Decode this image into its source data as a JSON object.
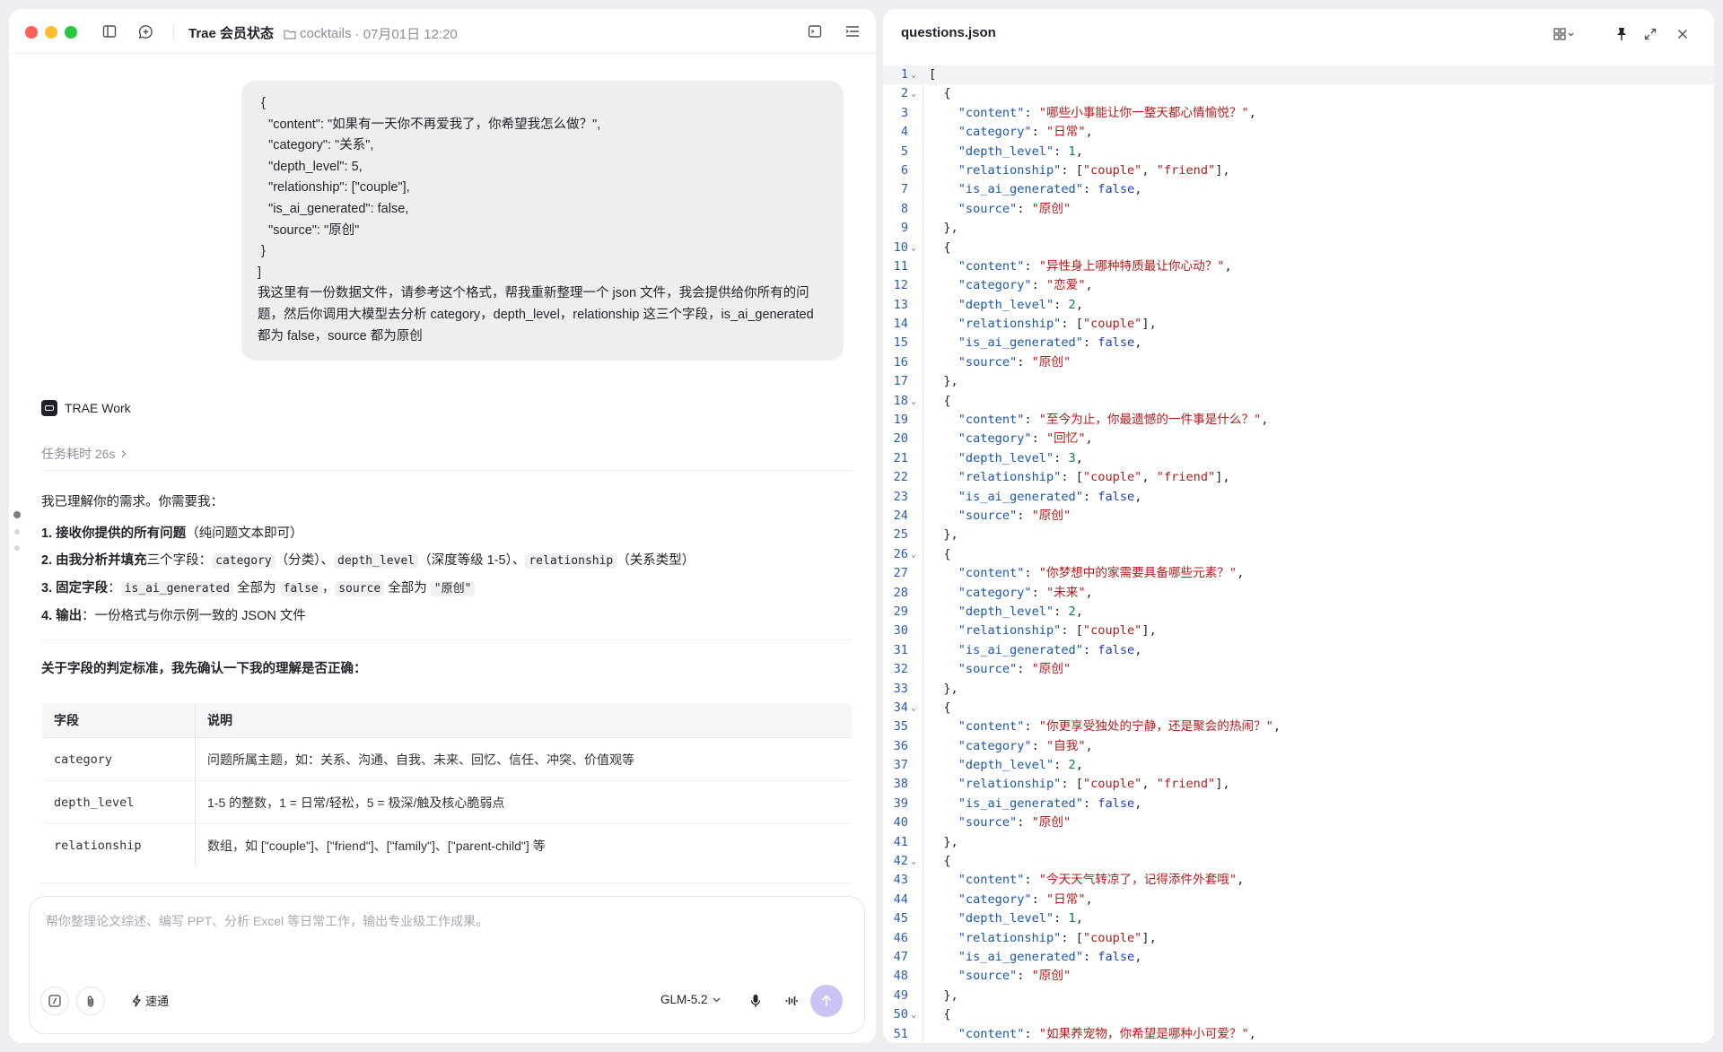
{
  "left": {
    "title": "Trae 会员状态",
    "meta_folder": "cocktails",
    "meta_time": "· 07月01日 12:20",
    "user_message": {
      "code_lines": [
        " {",
        "   \"content\": \"如果有一天你不再爱我了，你希望我怎么做？\",",
        "   \"category\": \"关系\",",
        "   \"depth_level\": 5,",
        "   \"relationship\": [\"couple\"],",
        "   \"is_ai_generated\": false,",
        "   \"source\": \"原创\"",
        " }",
        "]"
      ],
      "text_lines": [
        "我这里有一份数据文件，请参考这个格式，帮我重新整理一个 json 文件，我会提供给你所有的问",
        "题，然后你调用大模型去分析 category，depth_level，relationship 这三个字段，is_ai_generated",
        "都为 false，source 都为原创"
      ]
    },
    "agent_name": "TRAE Work",
    "task_time": "任务耗时 26s",
    "intro": "我已理解你的需求。你需要我：",
    "steps": {
      "s1_bold": "1. 接收你提供的所有问题",
      "s1_rest": "（纯问题文本即可）",
      "s2_bold": "2. 由我分析并填充",
      "s2_a": "三个字段：",
      "s2_code1": "category",
      "s2_b": "（分类）、",
      "s2_code2": "depth_level",
      "s2_c": "（深度等级 1-5）、",
      "s2_code3": "relationship",
      "s2_d": "（关系类型）",
      "s3_bold": "3. 固定字段",
      "s3_a": "：",
      "s3_code1": "is_ai_generated",
      "s3_b": " 全部为 ",
      "s3_code2": "false",
      "s3_c": "，",
      "s3_code3": "source",
      "s3_d": " 全部为 ",
      "s3_code4": "\"原创\"",
      "s4_bold": "4. 输出",
      "s4_rest": "：一份格式与你示例一致的 JSON 文件"
    },
    "confirm_heading": "关于字段的判定标准，我先确认一下我的理解是否正确：",
    "table": {
      "headers": [
        "字段",
        "说明"
      ],
      "rows": [
        [
          "category",
          "问题所属主题，如：关系、沟通、自我、未来、回忆、信任、冲突、价值观等"
        ],
        [
          "depth_level",
          "1-5 的整数，1 = 日常/轻松，5 = 极深/触及核心脆弱点"
        ],
        [
          "relationship",
          "数组，如 [\"couple\"]、[\"friend\"]、[\"family\"]、[\"parent-child\"] 等"
        ]
      ]
    },
    "composer": {
      "placeholder": "帮你整理论文综述、编写 PPT、分析 Excel 等日常工作，输出专业级工作成果。",
      "speed_label": "速通",
      "model_label": "GLM-5.2"
    }
  },
  "right": {
    "file_name": "questions.json",
    "lines": [
      {
        "n": "1",
        "fold": true,
        "t": "["
      },
      {
        "n": "2",
        "fold": true,
        "t": "  {"
      },
      {
        "n": "3",
        "key": "content",
        "val": "\"哪些小事能让你一整天都心情愉悦？\"",
        "vt": "s"
      },
      {
        "n": "4",
        "key": "category",
        "val": "\"日常\"",
        "vt": "s"
      },
      {
        "n": "5",
        "key": "depth_level",
        "val": "1",
        "vt": "n"
      },
      {
        "n": "6",
        "key": "relationship",
        "arr": [
          "couple",
          "friend"
        ]
      },
      {
        "n": "7",
        "key": "is_ai_generated",
        "val": "false",
        "vt": "b"
      },
      {
        "n": "8",
        "key": "source",
        "val": "\"原创\"",
        "vt": "s",
        "last": true
      },
      {
        "n": "9",
        "t": "  },"
      },
      {
        "n": "10",
        "fold": true,
        "t": "  {"
      },
      {
        "n": "11",
        "key": "content",
        "val": "\"异性身上哪种特质最让你心动？\"",
        "vt": "s"
      },
      {
        "n": "12",
        "key": "category",
        "val": "\"恋爱\"",
        "vt": "s"
      },
      {
        "n": "13",
        "key": "depth_level",
        "val": "2",
        "vt": "n"
      },
      {
        "n": "14",
        "key": "relationship",
        "arr": [
          "couple"
        ]
      },
      {
        "n": "15",
        "key": "is_ai_generated",
        "val": "false",
        "vt": "b"
      },
      {
        "n": "16",
        "key": "source",
        "val": "\"原创\"",
        "vt": "s",
        "last": true
      },
      {
        "n": "17",
        "t": "  },"
      },
      {
        "n": "18",
        "fold": true,
        "t": "  {"
      },
      {
        "n": "19",
        "key": "content",
        "val": "\"至今为止，你最遗憾的一件事是什么？\"",
        "vt": "s"
      },
      {
        "n": "20",
        "key": "category",
        "val": "\"回忆\"",
        "vt": "s"
      },
      {
        "n": "21",
        "key": "depth_level",
        "val": "3",
        "vt": "n"
      },
      {
        "n": "22",
        "key": "relationship",
        "arr": [
          "couple",
          "friend"
        ]
      },
      {
        "n": "23",
        "key": "is_ai_generated",
        "val": "false",
        "vt": "b"
      },
      {
        "n": "24",
        "key": "source",
        "val": "\"原创\"",
        "vt": "s",
        "last": true
      },
      {
        "n": "25",
        "t": "  },"
      },
      {
        "n": "26",
        "fold": true,
        "t": "  {"
      },
      {
        "n": "27",
        "key": "content",
        "val": "\"你梦想中的家需要具备哪些元素？\"",
        "vt": "s"
      },
      {
        "n": "28",
        "key": "category",
        "val": "\"未来\"",
        "vt": "s"
      },
      {
        "n": "29",
        "key": "depth_level",
        "val": "2",
        "vt": "n"
      },
      {
        "n": "30",
        "key": "relationship",
        "arr": [
          "couple"
        ]
      },
      {
        "n": "31",
        "key": "is_ai_generated",
        "val": "false",
        "vt": "b"
      },
      {
        "n": "32",
        "key": "source",
        "val": "\"原创\"",
        "vt": "s",
        "last": true
      },
      {
        "n": "33",
        "t": "  },"
      },
      {
        "n": "34",
        "fold": true,
        "t": "  {"
      },
      {
        "n": "35",
        "key": "content",
        "val": "\"你更享受独处的宁静，还是聚会的热闹？\"",
        "vt": "s"
      },
      {
        "n": "36",
        "key": "category",
        "val": "\"自我\"",
        "vt": "s"
      },
      {
        "n": "37",
        "key": "depth_level",
        "val": "2",
        "vt": "n"
      },
      {
        "n": "38",
        "key": "relationship",
        "arr": [
          "couple",
          "friend"
        ]
      },
      {
        "n": "39",
        "key": "is_ai_generated",
        "val": "false",
        "vt": "b"
      },
      {
        "n": "40",
        "key": "source",
        "val": "\"原创\"",
        "vt": "s",
        "last": true
      },
      {
        "n": "41",
        "t": "  },"
      },
      {
        "n": "42",
        "fold": true,
        "t": "  {"
      },
      {
        "n": "43",
        "key": "content",
        "val": "\"今天天气转凉了，记得添件外套哦\"",
        "vt": "s"
      },
      {
        "n": "44",
        "key": "category",
        "val": "\"日常\"",
        "vt": "s"
      },
      {
        "n": "45",
        "key": "depth_level",
        "val": "1",
        "vt": "n"
      },
      {
        "n": "46",
        "key": "relationship",
        "arr": [
          "couple"
        ]
      },
      {
        "n": "47",
        "key": "is_ai_generated",
        "val": "false",
        "vt": "b"
      },
      {
        "n": "48",
        "key": "source",
        "val": "\"原创\"",
        "vt": "s",
        "last": true
      },
      {
        "n": "49",
        "t": "  },"
      },
      {
        "n": "50",
        "fold": true,
        "t": "  {"
      },
      {
        "n": "51",
        "key": "content",
        "val": "\"如果养宠物，你希望是哪种小可爱？\"",
        "vt": "s"
      }
    ]
  },
  "colors": {
    "accent_send": "#c9c3f6",
    "line_number": "#2b5ea8",
    "json_key": "#1a56a8",
    "json_string": "#b31b1b"
  }
}
